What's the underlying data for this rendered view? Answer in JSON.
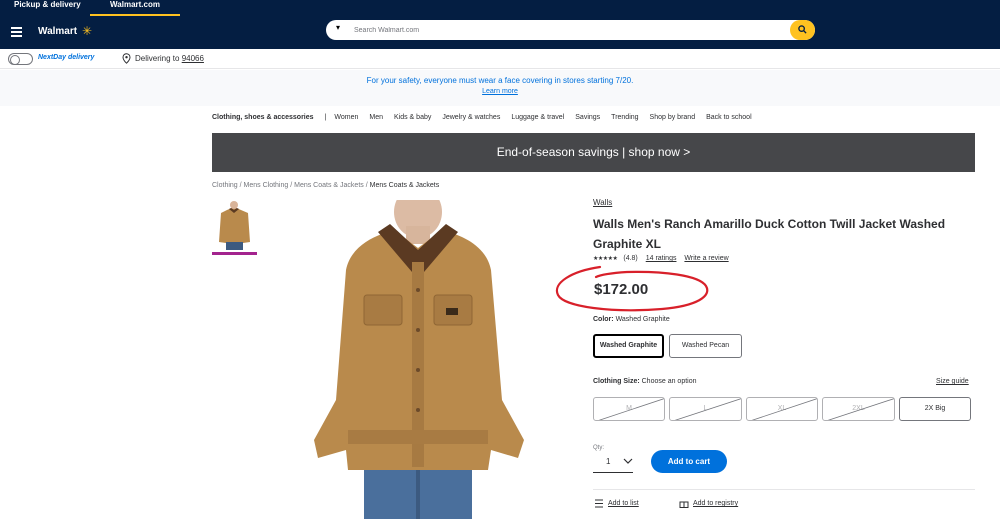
{
  "header": {
    "tabs": [
      "Pickup & delivery",
      "Walmart.com"
    ],
    "logo": "Walmart",
    "search_placeholder": "Search Walmart.com"
  },
  "subbar": {
    "nextday": "NextDay delivery",
    "delivering_prefix": "Delivering to ",
    "zip": "94066"
  },
  "banner": {
    "message": "For your safety, everyone must wear a face covering in stores starting 7/20.",
    "link": "Learn more"
  },
  "category_nav": [
    "Clothing, shoes & accessories",
    "Women",
    "Men",
    "Kids & baby",
    "Jewelry & watches",
    "Luggage & travel",
    "Savings",
    "Trending",
    "Shop by brand",
    "Back to school"
  ],
  "promo": "End-of-season savings | shop now >",
  "breadcrumb": [
    "Clothing",
    "Mens Clothing",
    "Mens Coats & Jackets",
    "Mens Coats & Jackets"
  ],
  "product": {
    "brand": "Walls",
    "title": "Walls Men's Ranch Amarillo Duck Cotton Twill Jacket Washed Graphite XL",
    "stars": "★★★★★",
    "rating_value": "(4.8)",
    "rating_count": "14 ratings",
    "write_review": "Write a review",
    "price": "$172.00",
    "color_label": "Color:",
    "color_value": "Washed Graphite",
    "colors": [
      "Washed Graphite",
      "Washed Pecan"
    ],
    "size_label": "Clothing Size:",
    "size_value": "Choose an option",
    "size_guide": "Size guide",
    "sizes": [
      "M",
      "L",
      "XL",
      "2XL",
      "2X Big"
    ],
    "qty_label": "Qty:",
    "qty": "1",
    "add_to_cart": "Add to cart",
    "add_to_list": "Add to list",
    "add_to_registry": "Add to registry"
  },
  "colors": {
    "navy": "#041e42",
    "yellow": "#ffc220",
    "blue": "#0071dc",
    "annotation_red": "#d8202a"
  }
}
